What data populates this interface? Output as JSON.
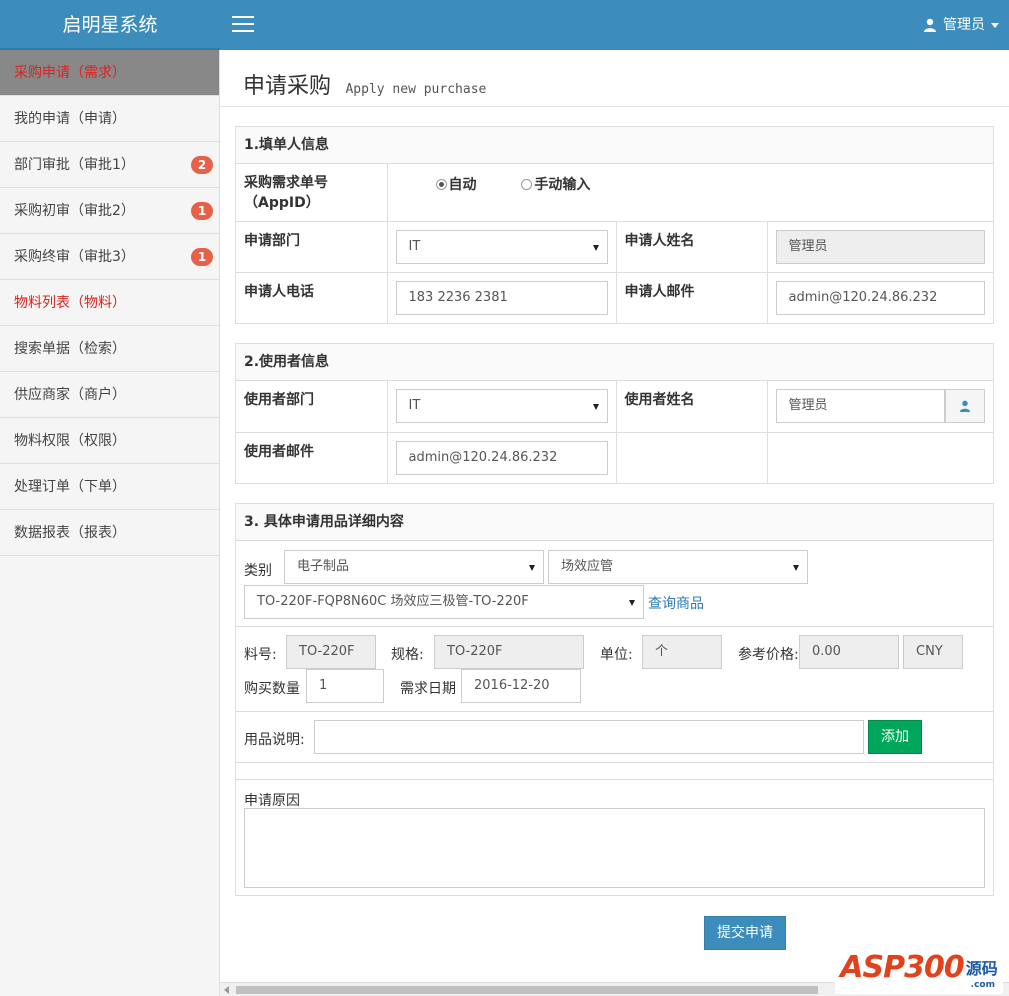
{
  "brand": "启明星系统",
  "header": {
    "user": "管理员"
  },
  "sidebar": {
    "items": [
      {
        "label": "采购申请（需求）"
      },
      {
        "label": "我的申请（申请）"
      },
      {
        "label": "部门审批（审批1）",
        "badge": "2"
      },
      {
        "label": "采购初审（审批2）",
        "badge": "1"
      },
      {
        "label": "采购终审（审批3）",
        "badge": "1"
      },
      {
        "label": "物料列表（物料）"
      },
      {
        "label": "搜索单据（检索）"
      },
      {
        "label": "供应商家（商户）"
      },
      {
        "label": "物料权限（权限）"
      },
      {
        "label": "处理订单（下单）"
      },
      {
        "label": "数据报表（报表）"
      }
    ]
  },
  "page": {
    "title": "申请采购",
    "subtitle": "Apply new purchase"
  },
  "section1": {
    "heading": "1.填单人信息",
    "appid_label": "采购需求单号（AppID）",
    "radio_auto": "自动",
    "radio_manual": "手动输入",
    "dept_label": "申请部门",
    "dept_value": "IT",
    "name_label": "申请人姓名",
    "name_value": "管理员",
    "phone_label": "申请人电话",
    "phone_value": "183 2236 2381",
    "email_label": "申请人邮件",
    "email_value": "admin@120.24.86.232"
  },
  "section2": {
    "heading": "2.使用者信息",
    "dept_label": "使用者部门",
    "dept_value": "IT",
    "name_label": "使用者姓名",
    "name_value": "管理员",
    "email_label": "使用者邮件",
    "email_value": "admin@120.24.86.232"
  },
  "section3": {
    "heading": "3. 具体申请用品详细内容",
    "category_label": "类别",
    "category_value": "电子制品",
    "subcategory_value": "场效应管",
    "product_value": "TO-220F-FQP8N60C 场效应三极管-TO-220F",
    "query_link": "查询商品",
    "partno_label": "料号:",
    "partno_value": "TO-220F",
    "spec_label": "规格:",
    "spec_value": "TO-220F",
    "unit_label": "单位:",
    "unit_value": "个",
    "price_label": "参考价格:",
    "price_value": "0.00",
    "currency_value": "CNY",
    "qty_label": "购买数量",
    "qty_value": "1",
    "date_label": "需求日期",
    "date_value": "2016-12-20",
    "desc_label": "用品说明:",
    "desc_value": "",
    "add_button": "添加",
    "reason_label": "申请原因",
    "reason_value": ""
  },
  "submit_button": "提交申请",
  "watermark": {
    "text": "ASP300",
    "cn": "源码",
    "domain": ".com"
  }
}
